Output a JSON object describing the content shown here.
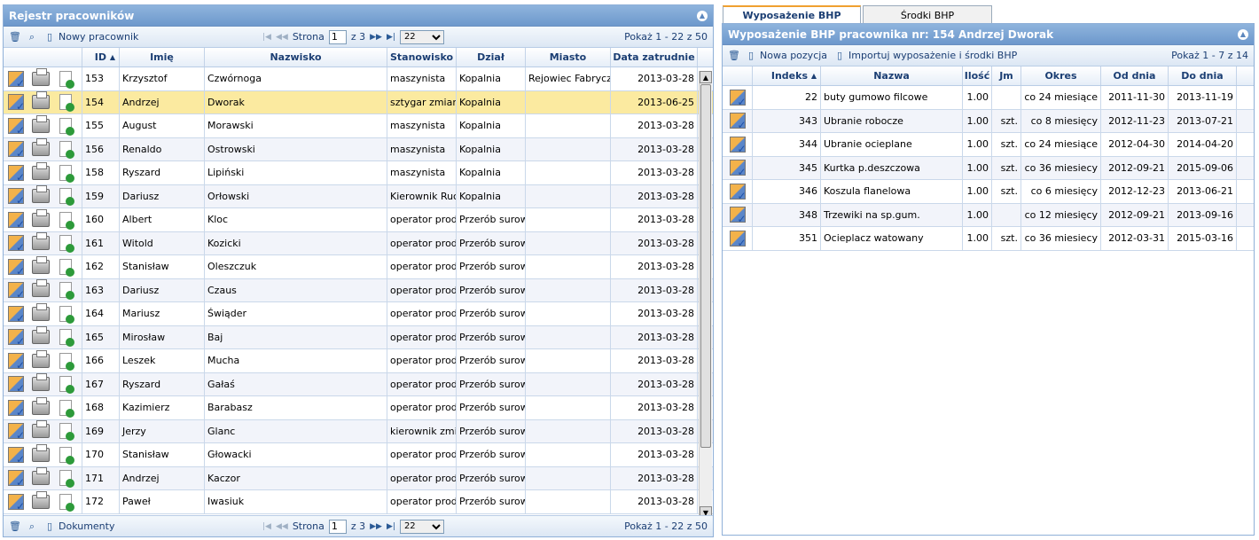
{
  "left": {
    "title": "Rejestr pracowników",
    "toolbar": {
      "new_label": "Nowy pracownik",
      "page_label": "Strona",
      "page_value": "1",
      "of_pages": "z 3",
      "per_page": "22",
      "info": "Pokaż 1 - 22 z 50"
    },
    "footer": {
      "docs_label": "Dokumenty",
      "page_label": "Strona",
      "page_value": "1",
      "of_pages": "z 3",
      "per_page": "22",
      "info": "Pokaż 1 - 22 z 50"
    },
    "columns": [
      "ID",
      "Imię",
      "Nazwisko",
      "Stanowisko",
      "Dział",
      "Miasto",
      "Data zatrudnie"
    ],
    "rows": [
      {
        "id": "153",
        "first": "Krzysztof",
        "last": "Czwórnoga",
        "pos": "maszynista",
        "dept": "Kopalnia",
        "city": "Rejowiec Fabrycz",
        "date": "2013-03-28"
      },
      {
        "id": "154",
        "first": "Andrzej",
        "last": "Dworak",
        "pos": "sztygar zmian",
        "dept": "Kopalnia",
        "city": "",
        "date": "2013-06-25"
      },
      {
        "id": "155",
        "first": "August",
        "last": "Morawski",
        "pos": "maszynista",
        "dept": "Kopalnia",
        "city": "",
        "date": "2013-03-28"
      },
      {
        "id": "156",
        "first": "Renaldo",
        "last": "Ostrowski",
        "pos": "maszynista",
        "dept": "Kopalnia",
        "city": "",
        "date": "2013-03-28"
      },
      {
        "id": "158",
        "first": "Ryszard",
        "last": "Lipiński",
        "pos": "maszynista",
        "dept": "Kopalnia",
        "city": "",
        "date": "2013-03-28"
      },
      {
        "id": "159",
        "first": "Dariusz",
        "last": "Orłowski",
        "pos": "Kierownik Ruc",
        "dept": "Kopalnia",
        "city": "",
        "date": "2013-03-28"
      },
      {
        "id": "160",
        "first": "Albert",
        "last": "Kloc",
        "pos": "operator prod",
        "dept": "Przerób surow",
        "city": "",
        "date": "2013-03-28"
      },
      {
        "id": "161",
        "first": "Witold",
        "last": "Kozicki",
        "pos": "operator prod",
        "dept": "Przerób surow",
        "city": "",
        "date": "2013-03-28"
      },
      {
        "id": "162",
        "first": "Stanisław",
        "last": "Oleszczuk",
        "pos": "operator prod",
        "dept": "Przerób surow",
        "city": "",
        "date": "2013-03-28"
      },
      {
        "id": "163",
        "first": "Dariusz",
        "last": "Czaus",
        "pos": "operator prod",
        "dept": "Przerób surow",
        "city": "",
        "date": "2013-03-28"
      },
      {
        "id": "164",
        "first": "Mariusz",
        "last": "Świąder",
        "pos": "operator prod",
        "dept": "Przerób surow",
        "city": "",
        "date": "2013-03-28"
      },
      {
        "id": "165",
        "first": "Mirosław",
        "last": "Baj",
        "pos": "operator prod",
        "dept": "Przerób surow",
        "city": "",
        "date": "2013-03-28"
      },
      {
        "id": "166",
        "first": "Leszek",
        "last": "Mucha",
        "pos": "operator prod",
        "dept": "Przerób surow",
        "city": "",
        "date": "2013-03-28"
      },
      {
        "id": "167",
        "first": "Ryszard",
        "last": "Gałaś",
        "pos": "operator prod",
        "dept": "Przerób surow",
        "city": "",
        "date": "2013-03-28"
      },
      {
        "id": "168",
        "first": "Kazimierz",
        "last": "Barabasz",
        "pos": "operator prod",
        "dept": "Przerób surow",
        "city": "",
        "date": "2013-03-28"
      },
      {
        "id": "169",
        "first": "Jerzy",
        "last": "Glanc",
        "pos": "kierownik zmi",
        "dept": "Przerób surow",
        "city": "",
        "date": "2013-03-28"
      },
      {
        "id": "170",
        "first": "Stanisław",
        "last": "Głowacki",
        "pos": "operator prod",
        "dept": "Przerób surow",
        "city": "",
        "date": "2013-03-28"
      },
      {
        "id": "171",
        "first": "Andrzej",
        "last": "Kaczor",
        "pos": "operator prod",
        "dept": "Przerób surow",
        "city": "",
        "date": "2013-03-28"
      },
      {
        "id": "172",
        "first": "Paweł",
        "last": "Iwasiuk",
        "pos": "operator prod",
        "dept": "Przerób surow",
        "city": "",
        "date": "2013-03-28"
      }
    ]
  },
  "tabs": [
    "Wyposażenie BHP",
    "Środki BHP"
  ],
  "right": {
    "title": "Wyposażenie BHP pracownika nr: 154 Andrzej Dworak",
    "toolbar": {
      "new_label": "Nowa pozycja",
      "import_label": "Importuj wyposażenie i środki BHP",
      "info": "Pokaż 1 - 7 z 14"
    },
    "columns": [
      "Indeks",
      "Nazwa",
      "Ilość",
      "Jm",
      "Okres",
      "Od dnia",
      "Do dnia"
    ],
    "rows": [
      {
        "idx": "22",
        "name": "buty gumowo filcowe",
        "qty": "1.00",
        "jm": "",
        "period": "co 24 miesiące",
        "from": "2011-11-30",
        "to": "2013-11-19"
      },
      {
        "idx": "343",
        "name": "Ubranie robocze",
        "qty": "1.00",
        "jm": "szt.",
        "period": "co 8 miesięcy",
        "from": "2012-11-23",
        "to": "2013-07-21"
      },
      {
        "idx": "344",
        "name": "Ubranie ocieplane",
        "qty": "1.00",
        "jm": "szt.",
        "period": "co 24 miesiące",
        "from": "2012-04-30",
        "to": "2014-04-20"
      },
      {
        "idx": "345",
        "name": "Kurtka p.deszczowa",
        "qty": "1.00",
        "jm": "szt.",
        "period": "co 36 miesiecy",
        "from": "2012-09-21",
        "to": "2015-09-06"
      },
      {
        "idx": "346",
        "name": "Koszula flanelowa",
        "qty": "1.00",
        "jm": "szt.",
        "period": "co 6 miesięcy",
        "from": "2012-12-23",
        "to": "2013-06-21"
      },
      {
        "idx": "348",
        "name": "Trzewiki na sp.gum.",
        "qty": "1.00",
        "jm": "",
        "period": "co 12 miesięcy",
        "from": "2012-09-21",
        "to": "2013-09-16"
      },
      {
        "idx": "351",
        "name": "Ocieplacz watowany",
        "qty": "1.00",
        "jm": "szt.",
        "period": "co 36 miesiecy",
        "from": "2012-03-31",
        "to": "2015-03-16"
      }
    ]
  }
}
